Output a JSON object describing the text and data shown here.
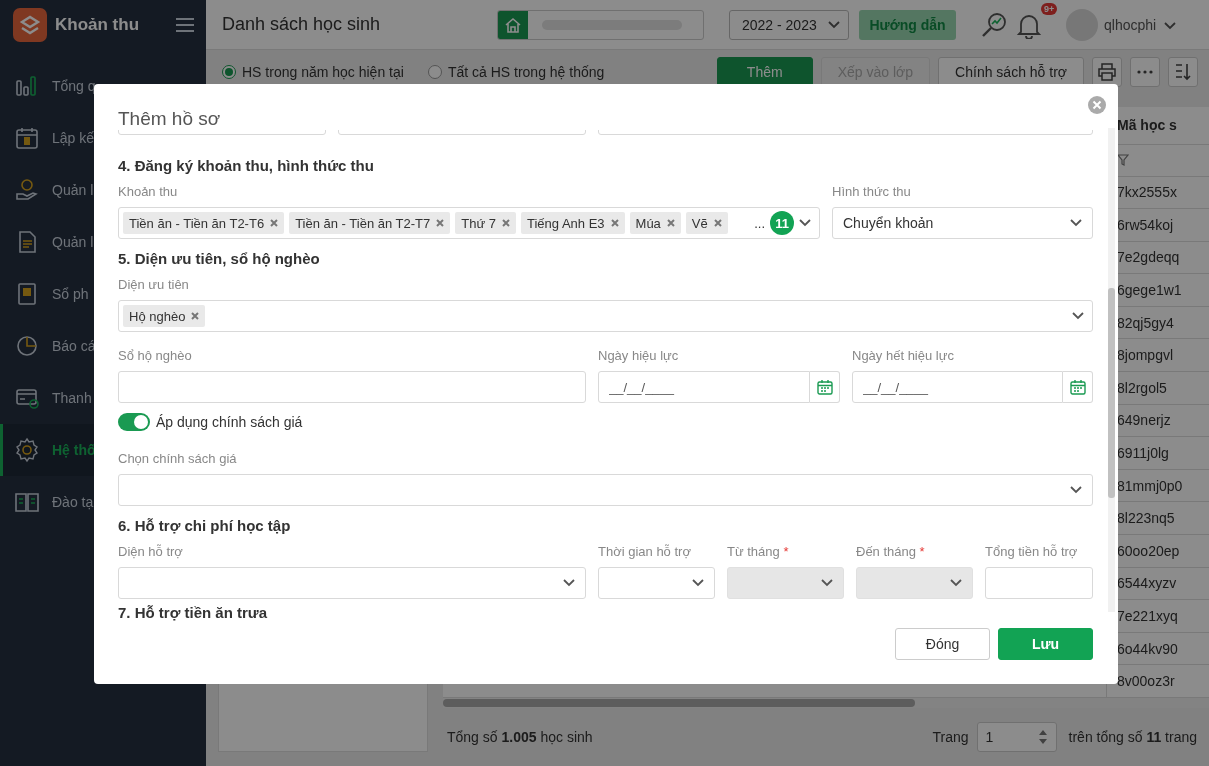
{
  "app": {
    "title": "Khoản thu"
  },
  "sidebar": {
    "items": [
      {
        "label": "Tổng q",
        "selected": false
      },
      {
        "label": "Lập kế",
        "selected": false
      },
      {
        "label": "Quản l",
        "selected": false
      },
      {
        "label": "Quản l",
        "selected": false
      },
      {
        "label": "Sổ ph",
        "selected": false
      },
      {
        "label": "Báo cá",
        "selected": false
      },
      {
        "label": "Thanh",
        "selected": false
      },
      {
        "label": "Hệ thố",
        "selected": true
      },
      {
        "label": "Đào tạ",
        "selected": false
      }
    ]
  },
  "header": {
    "page_title": "Danh sách học sinh",
    "school_year": "2022 - 2023",
    "help_button": "Hướng dẫn",
    "notification_badge": "9+",
    "username": "qlhocphi"
  },
  "toolbar": {
    "scope_options": [
      {
        "label": "HS trong năm học hiện tại",
        "selected": true
      },
      {
        "label": "Tất cả HS trong hệ thống",
        "selected": false
      }
    ],
    "buttons": [
      {
        "label": "Thêm",
        "kind": "primary",
        "disabled": false
      },
      {
        "label": "Xếp vào lớp",
        "kind": "secondary",
        "disabled": true
      },
      {
        "label": "Chính sách hỗ trợ",
        "kind": "secondary",
        "disabled": false
      }
    ]
  },
  "table": {
    "columns": [
      {
        "label": "Mã học s"
      }
    ],
    "rows": [
      {
        "code": "7kx2555x"
      },
      {
        "code": "6rw54koj"
      },
      {
        "code": "7e2gdeqq"
      },
      {
        "code": "6gege1w1"
      },
      {
        "code": "82qj5gy4"
      },
      {
        "code": "8jompgvl"
      },
      {
        "code": "8l2rgol5"
      },
      {
        "code": "649nerjz"
      },
      {
        "code": "6911j0lg"
      },
      {
        "code": "81mmj0p0"
      },
      {
        "code": "8l223nq5"
      },
      {
        "code": "60oo20ep"
      },
      {
        "code": "6544xyzv"
      },
      {
        "code": "7e221xyq"
      },
      {
        "code": "6o44kv90"
      },
      {
        "code": "8v00oz3r"
      }
    ]
  },
  "footer": {
    "total": "Tổng số **1.005** học sinh",
    "page_label": "Trang",
    "page": "1",
    "page_total": "trên tổng số **11** trang"
  },
  "dialog": {
    "title": "Thêm hồ sơ",
    "rows": [
      {
        "kind": "fields",
        "fields": [
          {
            "kind": "text"
          },
          {
            "kind": "text"
          },
          {
            "kind": "text"
          }
        ]
      },
      {
        "kind": "heading",
        "text": "4. Đăng ký khoản thu, hình thức thu"
      },
      {
        "kind": "fields",
        "fields": [
          {
            "kind": "multiselect",
            "label": "Khoản thu",
            "tags": [
              "Tiền ăn - Tiền ăn T2-T6",
              "Tiền ăn - Tiền ăn T2-T7",
              "Thứ 7",
              "Tiếng Anh E3",
              "Múa",
              "Vẽ"
            ],
            "overflow_mark": "...",
            "count": "11"
          },
          {
            "kind": "select",
            "label": "Hình thức thu",
            "value": "Chuyển khoản"
          }
        ]
      },
      {
        "kind": "heading",
        "text": "5. Diện ưu tiên, sổ hộ nghèo"
      },
      {
        "kind": "fields",
        "fields": [
          {
            "kind": "multiselect",
            "label": "Diện ưu tiên",
            "tags": [
              "Hộ nghèo"
            ]
          }
        ]
      },
      {
        "kind": "fields",
        "fields": [
          {
            "kind": "text",
            "label": "Sổ hộ nghèo"
          },
          {
            "kind": "date",
            "label": "Ngày hiệu lực",
            "placeholder": "__/__/____"
          },
          {
            "kind": "date",
            "label": "Ngày hết hiệu lực",
            "placeholder": "__/__/____"
          }
        ]
      },
      {
        "kind": "toggle",
        "label": "Áp dụng chính sách giá",
        "on": true
      },
      {
        "kind": "fields",
        "fields": [
          {
            "kind": "select",
            "label": "Chọn chính sách giá"
          }
        ]
      },
      {
        "kind": "heading",
        "text": "6. Hỗ trợ chi phí học tập"
      },
      {
        "kind": "fields",
        "fields": [
          {
            "kind": "select",
            "label": "Diện hỗ trợ",
            "disabled": false
          },
          {
            "kind": "select",
            "label": "Thời gian hỗ trợ",
            "disabled": false
          },
          {
            "kind": "select",
            "label": "Từ tháng",
            "required_mark": "*",
            "disabled": true
          },
          {
            "kind": "select",
            "label": "Đến tháng",
            "required_mark": "*",
            "disabled": true
          },
          {
            "kind": "text",
            "label": "Tổng tiền hỗ trợ",
            "disabled": false
          }
        ]
      },
      {
        "kind": "heading",
        "text": "7. Hỗ trợ tiền ăn trưa"
      }
    ],
    "buttons": [
      {
        "label": "Đóng",
        "kind": "secondary"
      },
      {
        "label": "Lưu",
        "kind": "primary"
      }
    ]
  }
}
